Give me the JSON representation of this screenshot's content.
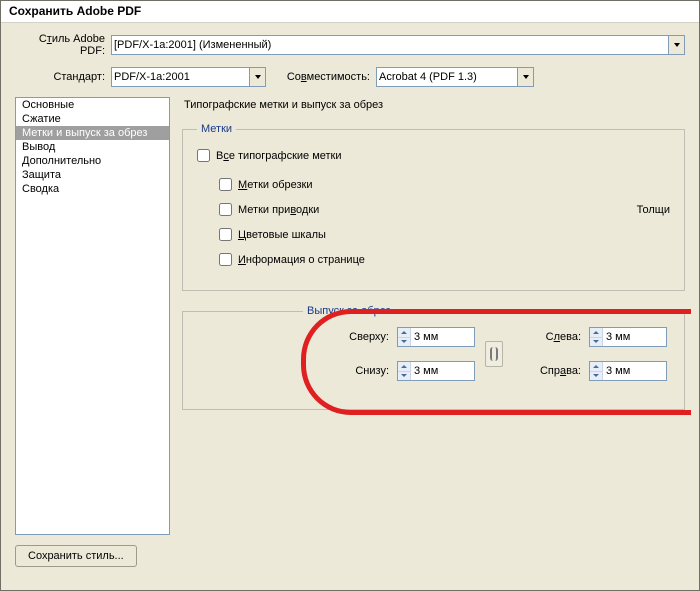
{
  "window_title": "Сохранить Adobe PDF",
  "top": {
    "style_label_pre": "С",
    "style_label_u": "т",
    "style_label_post": "иль Adobe PDF:",
    "style_value": "[PDF/X-1a:2001] (Измененный)",
    "standard_label": "Стандарт:",
    "standard_value": "PDF/X-1a:2001",
    "compat_label_pre": "Со",
    "compat_label_u": "в",
    "compat_label_post": "местимость:",
    "compat_value": "Acrobat 4 (PDF 1.3)"
  },
  "sidebar": {
    "items": [
      "Основные",
      "Сжатие",
      "Метки и выпуск за обрез",
      "Вывод",
      "Дополнительно",
      "Защита",
      "Сводка"
    ],
    "selected_index": 2
  },
  "panel": {
    "title": "Типографские метки и выпуск за обрез",
    "marks_legend": "Метки",
    "checks": {
      "all_pre": "В",
      "all_u": "с",
      "all_post": "е типографские метки",
      "trim_u": "М",
      "trim_post": "етки обрезки",
      "reg_pre": "Метки при",
      "reg_u": "в",
      "reg_post": "одки",
      "color_u": "Ц",
      "color_post": "ветовые шкалы",
      "page_u": "И",
      "page_post": "нформация о странице"
    },
    "thickness_label": "Толщи",
    "bleed_legend": "Выпуск за обрез",
    "bleed": {
      "top_label": "Сверху:",
      "bottom_label": "Снизу:",
      "left_label_pre": "С",
      "left_label_u": "л",
      "left_label_post": "ева:",
      "right_label_pre": "Спр",
      "right_label_u": "а",
      "right_label_post": "ва:",
      "top_value": "3 мм",
      "bottom_value": "3 мм",
      "left_value": "3 мм",
      "right_value": "3 мм"
    }
  },
  "save_style_label": "Сохранить стиль..."
}
